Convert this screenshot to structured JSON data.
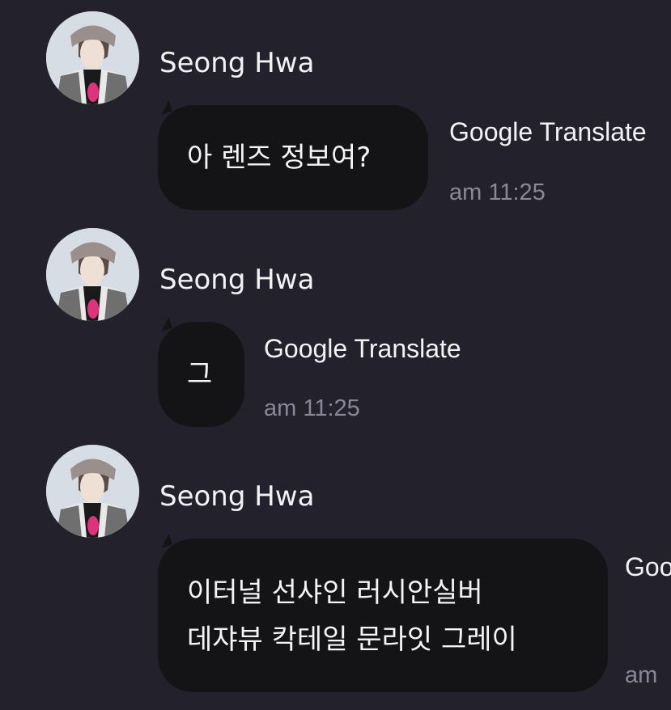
{
  "messages": [
    {
      "sender": "Seong Hwa",
      "lines": [
        "아 렌즈 정보여?"
      ],
      "translate_label": "Google Translate",
      "time": "am 11:25"
    },
    {
      "sender": "Seong Hwa",
      "lines": [
        "그"
      ],
      "translate_label": "Google Translate",
      "time": "am 11:25"
    },
    {
      "sender": "Seong Hwa",
      "lines": [
        "이터널 선샤인 러시안실버",
        "데쟈뷰 칵테일 문라잇 그레이"
      ],
      "translate_label": "Goo",
      "time": "am"
    }
  ],
  "colors": {
    "background": "#23222c",
    "bubble": "#141416",
    "text": "#f4f4f6",
    "timestamp": "#8a8799",
    "avatar_accent": "#e0327a"
  },
  "icons": {
    "avatar": "profile-photo"
  }
}
